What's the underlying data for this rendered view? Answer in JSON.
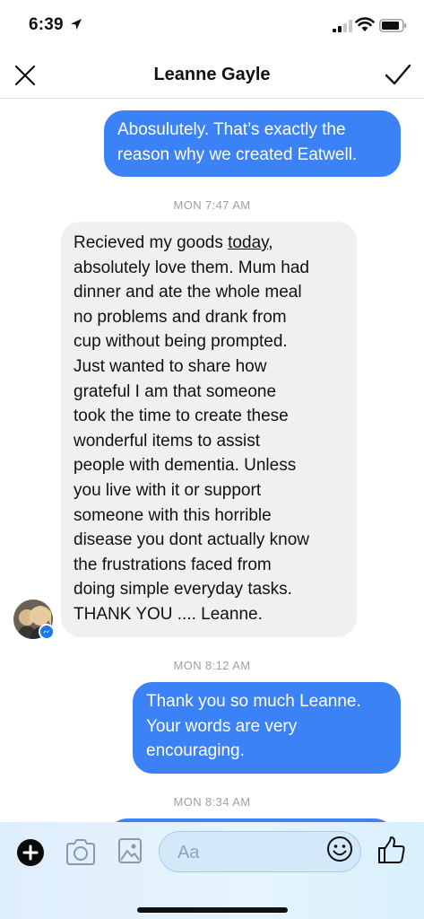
{
  "status_bar": {
    "time": "6:39",
    "icons": [
      "location-arrow-icon",
      "cellular-signal-icon",
      "wifi-icon",
      "battery-icon"
    ]
  },
  "header": {
    "title": "Leanne Gayle",
    "left_icon": "close-icon",
    "right_icon": "checkmark-icon"
  },
  "messages": [
    {
      "type": "outgoing",
      "lines": [
        "Abosulutely. That’s exactly the",
        "reason why we created Eatwell."
      ]
    },
    {
      "type": "timestamp",
      "text": "MON 7:47 AM"
    },
    {
      "type": "incoming",
      "underline_word": "today",
      "lines": [
        "Recieved my goods ",
        "today",
        ",",
        "absolutely love them. Mum had",
        "dinner and ate the whole meal",
        "no problems and drank from",
        "cup without being prompted.",
        "Just wanted to share how",
        "grateful I am that someone",
        "took the time to create these",
        "wonderful items to assist",
        "people with dementia. Unless",
        "you live with it or support",
        "someone with this horrible",
        "disease you dont actually know",
        "the frustrations faced from",
        "doing simple everyday tasks.",
        "THANK YOU .... Leanne."
      ]
    },
    {
      "type": "timestamp",
      "text": "MON 8:12 AM"
    },
    {
      "type": "outgoing",
      "lines": [
        "Thank you so much Leanne.",
        "Your words are very",
        "encouraging."
      ]
    },
    {
      "type": "timestamp",
      "text": "MON 8:34 AM"
    }
  ],
  "composer": {
    "placeholder": "Aa",
    "icons": [
      "plus-icon",
      "camera-icon",
      "image-icon",
      "emoji-icon",
      "thumbs-up-icon"
    ]
  },
  "colors": {
    "outgoing_bubble": "#3b82f6",
    "incoming_bubble": "#f1f0f0",
    "timestamp": "#a0a0a0"
  }
}
